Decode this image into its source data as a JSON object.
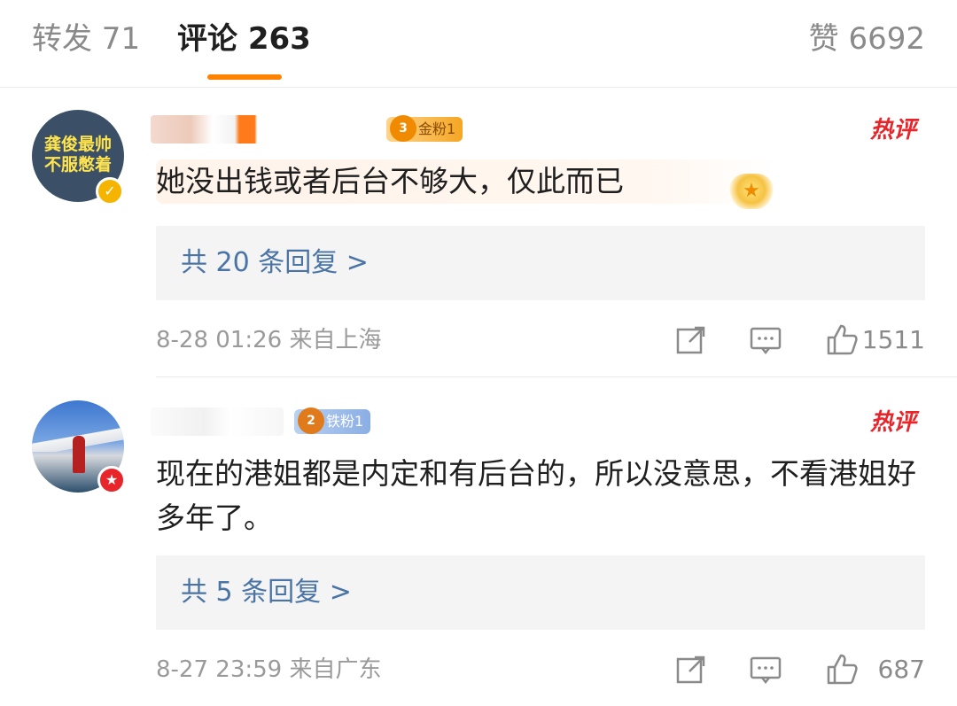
{
  "tabs": {
    "repost": "转发 71",
    "comment": "评论 263",
    "like": "赞 6692",
    "accent": "#ff8200"
  },
  "comments": [
    {
      "avatar_text": "龚俊最帅 不服憋着",
      "badge_icon": "verified-star-icon",
      "fan_level": "3",
      "fan_label": "金粉1",
      "hot_label": "热评",
      "text": "她没出钱或者后台不够大，仅此而已",
      "replies": "共 20 条回复 >",
      "time": "8-28 01:26  来自上海",
      "likes": "1511"
    },
    {
      "avatar_text": "",
      "badge_icon": "red-star-icon",
      "fan_level": "2",
      "fan_label": "铁粉1",
      "hot_label": "热评",
      "text": "现在的港姐都是内定和有后台的，所以没意思，不看港姐好多年了。",
      "replies": "共 5 条回复 >",
      "time": "8-27 23:59  来自广东",
      "likes": "687"
    }
  ],
  "colors": {
    "hot": "#e8252a",
    "link": "#4a74a6",
    "meta": "#9a9a9a"
  }
}
